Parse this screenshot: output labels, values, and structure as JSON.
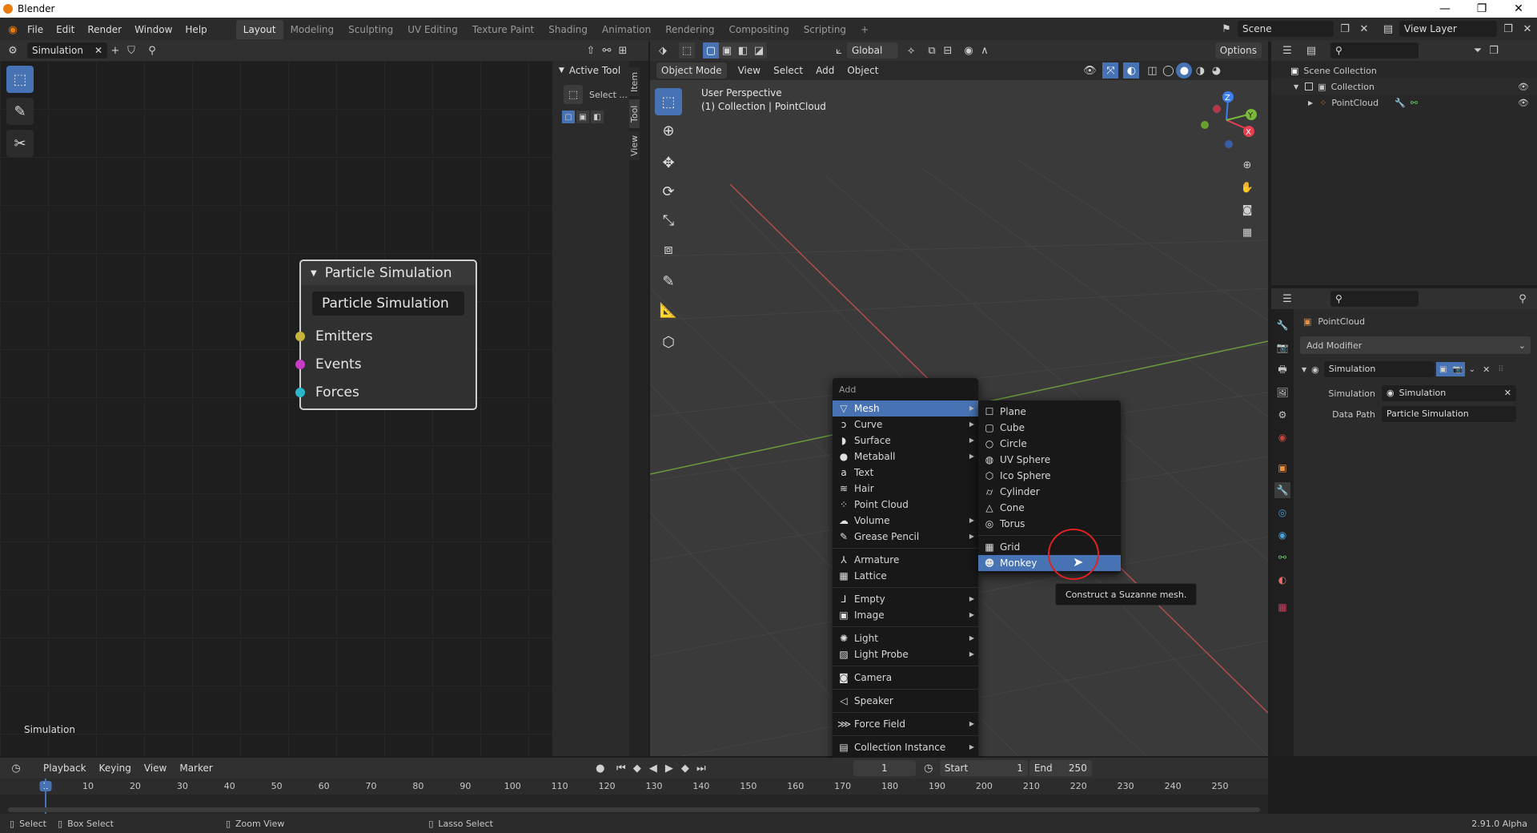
{
  "window": {
    "title": "Blender",
    "minimize": "—",
    "maximize": "❐",
    "close": "✕"
  },
  "menus": [
    "File",
    "Edit",
    "Render",
    "Window",
    "Help"
  ],
  "workspaces": [
    "Layout",
    "Modeling",
    "Sculpting",
    "UV Editing",
    "Texture Paint",
    "Shading",
    "Animation",
    "Rendering",
    "Compositing",
    "Scripting"
  ],
  "add_workspace": "+",
  "scene": {
    "name": "Scene",
    "view_layer": "View Layer"
  },
  "node_editor": {
    "tree_name": "Simulation",
    "footer_label": "Simulation",
    "node": {
      "header": "Particle Simulation",
      "name_field": "Particle Simulation",
      "sockets": [
        {
          "label": "Emitters",
          "color": "#c8b43a"
        },
        {
          "label": "Events",
          "color": "#c83ac8"
        },
        {
          "label": "Forces",
          "color": "#2ab8c8"
        }
      ]
    },
    "sidebar": {
      "panel_title": "Active Tool",
      "tool_label": "Select ...",
      "tabs": [
        "Item",
        "Tool",
        "View"
      ]
    }
  },
  "viewport": {
    "mode": "Object Mode",
    "header_menus": [
      "View",
      "Select",
      "Add",
      "Object"
    ],
    "orientation": "Global",
    "options": "Options",
    "overlay_title": "User Perspective",
    "overlay_sub": "(1) Collection | PointCloud",
    "gizmo": {
      "x": "X",
      "y": "Y",
      "z": "Z"
    }
  },
  "add_menu": {
    "title": "Add",
    "items": [
      {
        "label": "Mesh",
        "icon": "mesh-icon",
        "glyph": "▽",
        "submenu": true,
        "highlighted": true,
        "underline": "M"
      },
      {
        "label": "Curve",
        "icon": "curve-icon",
        "glyph": "ↄ",
        "submenu": true
      },
      {
        "label": "Surface",
        "icon": "surface-icon",
        "glyph": "◗",
        "submenu": true
      },
      {
        "label": "Metaball",
        "icon": "metaball-icon",
        "glyph": "●",
        "submenu": true
      },
      {
        "label": "Text",
        "icon": "text-icon",
        "glyph": "a",
        "submenu": false
      },
      {
        "label": "Hair",
        "icon": "hair-icon",
        "glyph": "≋",
        "submenu": false
      },
      {
        "label": "Point Cloud",
        "icon": "pointcloud-icon",
        "glyph": "⁘",
        "submenu": false
      },
      {
        "label": "Volume",
        "icon": "volume-icon",
        "glyph": "☁",
        "submenu": true
      },
      {
        "label": "Grease Pencil",
        "icon": "grease-pencil-icon",
        "glyph": "✎",
        "submenu": true,
        "sep_after": true
      },
      {
        "label": "Armature",
        "icon": "armature-icon",
        "glyph": "⅄",
        "submenu": false
      },
      {
        "label": "Lattice",
        "icon": "lattice-icon",
        "glyph": "▦",
        "submenu": false,
        "sep_after": true
      },
      {
        "label": "Empty",
        "icon": "empty-icon",
        "glyph": "⅃",
        "submenu": true
      },
      {
        "label": "Image",
        "icon": "image-icon",
        "glyph": "▣",
        "submenu": true,
        "sep_after": true
      },
      {
        "label": "Light",
        "icon": "light-icon",
        "glyph": "✺",
        "submenu": true
      },
      {
        "label": "Light Probe",
        "icon": "light-probe-icon",
        "glyph": "▨",
        "submenu": true,
        "sep_after": true
      },
      {
        "label": "Camera",
        "icon": "camera-icon",
        "glyph": "◙",
        "submenu": false,
        "sep_after": true
      },
      {
        "label": "Speaker",
        "icon": "speaker-icon",
        "glyph": "◁",
        "submenu": false,
        "sep_after": true
      },
      {
        "label": "Force Field",
        "icon": "force-field-icon",
        "glyph": "⋙",
        "submenu": true,
        "sep_after": true
      },
      {
        "label": "Collection Instance",
        "icon": "collection-instance-icon",
        "glyph": "▤",
        "submenu": true
      }
    ]
  },
  "mesh_submenu": {
    "items": [
      {
        "label": "Plane",
        "icon": "plane-icon",
        "glyph": "☐"
      },
      {
        "label": "Cube",
        "icon": "cube-icon",
        "glyph": "▢"
      },
      {
        "label": "Circle",
        "icon": "circle-icon",
        "glyph": "○"
      },
      {
        "label": "UV Sphere",
        "icon": "uv-sphere-icon",
        "glyph": "◍"
      },
      {
        "label": "Ico Sphere",
        "icon": "ico-sphere-icon",
        "glyph": "⬡"
      },
      {
        "label": "Cylinder",
        "icon": "cylinder-icon",
        "glyph": "⌭"
      },
      {
        "label": "Cone",
        "icon": "cone-icon",
        "glyph": "△"
      },
      {
        "label": "Torus",
        "icon": "torus-icon",
        "glyph": "◎",
        "sep_after": true
      },
      {
        "label": "Grid",
        "icon": "grid-icon",
        "glyph": "▦"
      },
      {
        "label": "Monkey",
        "icon": "monkey-icon",
        "glyph": "☻",
        "highlighted": true
      }
    ],
    "tooltip": "Construct a Suzanne mesh."
  },
  "outliner": {
    "root": "Scene Collection",
    "collection": "Collection",
    "object": "PointCloud"
  },
  "properties": {
    "object_name": "PointCloud",
    "add_modifier": "Add Modifier",
    "modifier_name": "Simulation",
    "fields": [
      {
        "label": "Simulation",
        "value": "Simulation"
      },
      {
        "label": "Data Path",
        "value": "Particle Simulation"
      }
    ]
  },
  "timeline": {
    "menus": [
      "Playback",
      "Keying",
      "View",
      "Marker"
    ],
    "current_frame": "1",
    "start_label": "Start",
    "start": "1",
    "end_label": "End",
    "end": "250",
    "ruler": [
      "1",
      "10",
      "20",
      "30",
      "40",
      "50",
      "60",
      "70",
      "80",
      "90",
      "100",
      "110",
      "120",
      "130",
      "140",
      "150",
      "160",
      "170",
      "180",
      "190",
      "200",
      "210",
      "220",
      "230",
      "240",
      "250"
    ]
  },
  "statusbar": {
    "items": [
      "Select",
      "Box Select",
      "Zoom View",
      "Lasso Select"
    ],
    "version": "2.91.0 Alpha"
  }
}
